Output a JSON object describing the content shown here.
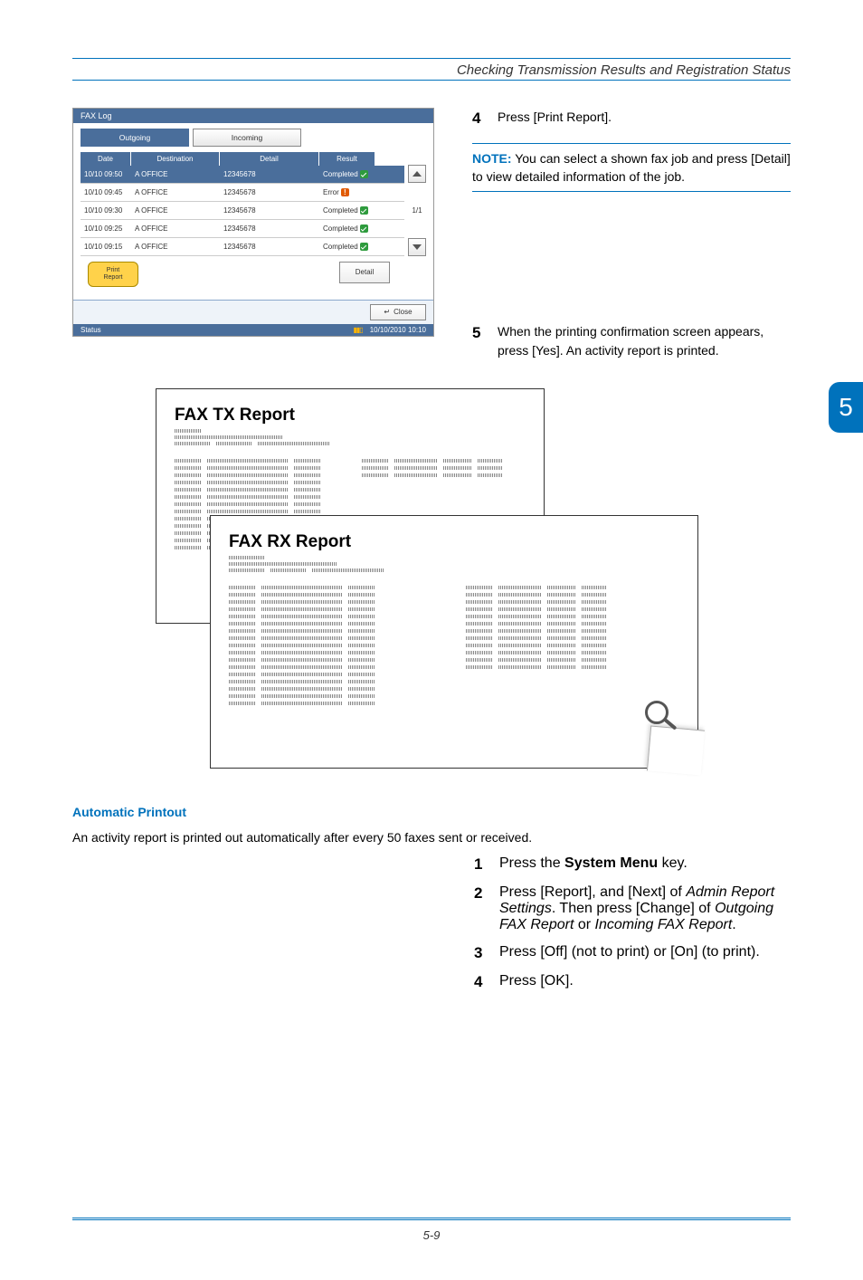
{
  "header": {
    "title": "Checking Transmission Results and Registration Status"
  },
  "big_tab": "5",
  "step4": {
    "num": "4",
    "text": "Press [Print Report]."
  },
  "note": {
    "label": "NOTE:",
    "text": " You can select a shown fax job and press [Detail] to view detailed information of the job."
  },
  "step5": {
    "num": "5",
    "text": "When the printing confirmation screen appears, press [Yes]. An activity report is printed."
  },
  "faxlog": {
    "title": "FAX Log",
    "tabs": {
      "outgoing": "Outgoing",
      "incoming": "Incoming"
    },
    "headers": {
      "date": "Date",
      "dest": "Destination",
      "detail": "Detail",
      "result": "Result"
    },
    "rows": [
      {
        "date": "10/10 09:50",
        "dest": "A OFFICE",
        "detail": "12345678",
        "result": "Completed",
        "ok": true,
        "sel": true
      },
      {
        "date": "10/10 09:45",
        "dest": "A OFFICE",
        "detail": "12345678",
        "result": "Error",
        "ok": false
      },
      {
        "date": "10/10 09:30",
        "dest": "A OFFICE",
        "detail": "12345678",
        "result": "Completed",
        "ok": true
      },
      {
        "date": "10/10 09:25",
        "dest": "A OFFICE",
        "detail": "12345678",
        "result": "Completed",
        "ok": true
      },
      {
        "date": "10/10 09:15",
        "dest": "A OFFICE",
        "detail": "12345678",
        "result": "Completed",
        "ok": true
      }
    ],
    "page": "1/1",
    "print_report": "Print\nReport",
    "detail_btn": "Detail",
    "close": "Close",
    "status": "Status",
    "timestamp": "10/10/2010  10:10"
  },
  "reports": {
    "tx": "FAX TX Report",
    "rx": "FAX RX Report"
  },
  "auto": {
    "heading": "Automatic Printout",
    "intro": "An activity report is printed out automatically after every 50 faxes sent or received.",
    "s1": {
      "num": "1",
      "a": "Press the ",
      "b": "System Menu",
      "c": " key."
    },
    "s2": {
      "num": "2",
      "a": "Press [Report], and [Next] of ",
      "b": "Admin Report Settings",
      "c": ". Then press [Change] of ",
      "d": "Outgoing FAX Report",
      "e": " or ",
      "f": "Incoming FAX Report",
      "g": "."
    },
    "s3": {
      "num": "3",
      "text": "Press [Off] (not to print) or [On] (to print)."
    },
    "s4": {
      "num": "4",
      "text": "Press [OK]."
    }
  },
  "pagenum": "5-9"
}
